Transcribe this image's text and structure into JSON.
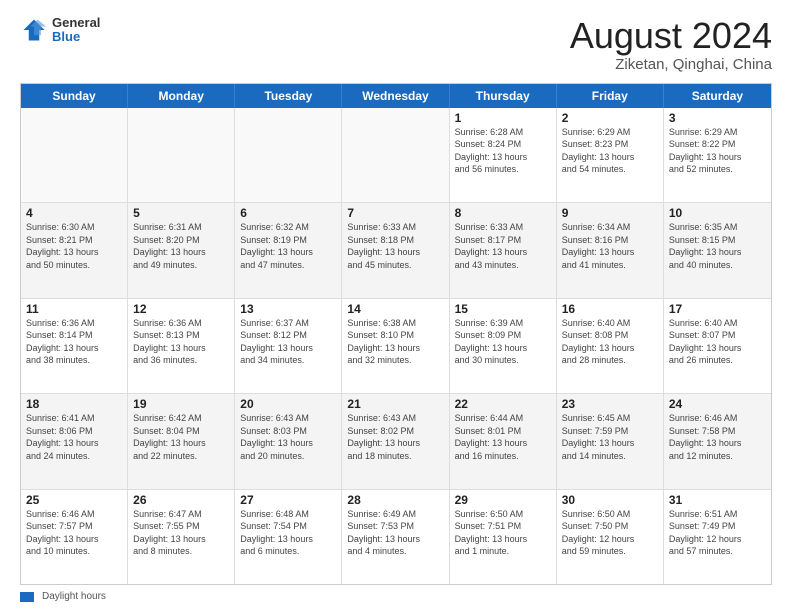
{
  "brand": {
    "general": "General",
    "blue": "Blue"
  },
  "title": {
    "month_year": "August 2024",
    "location": "Ziketan, Qinghai, China"
  },
  "days_of_week": [
    "Sunday",
    "Monday",
    "Tuesday",
    "Wednesday",
    "Thursday",
    "Friday",
    "Saturday"
  ],
  "footer": {
    "label": "Daylight hours"
  },
  "weeks": [
    [
      {
        "day": "",
        "info": ""
      },
      {
        "day": "",
        "info": ""
      },
      {
        "day": "",
        "info": ""
      },
      {
        "day": "",
        "info": ""
      },
      {
        "day": "1",
        "info": "Sunrise: 6:28 AM\nSunset: 8:24 PM\nDaylight: 13 hours\nand 56 minutes."
      },
      {
        "day": "2",
        "info": "Sunrise: 6:29 AM\nSunset: 8:23 PM\nDaylight: 13 hours\nand 54 minutes."
      },
      {
        "day": "3",
        "info": "Sunrise: 6:29 AM\nSunset: 8:22 PM\nDaylight: 13 hours\nand 52 minutes."
      }
    ],
    [
      {
        "day": "4",
        "info": "Sunrise: 6:30 AM\nSunset: 8:21 PM\nDaylight: 13 hours\nand 50 minutes."
      },
      {
        "day": "5",
        "info": "Sunrise: 6:31 AM\nSunset: 8:20 PM\nDaylight: 13 hours\nand 49 minutes."
      },
      {
        "day": "6",
        "info": "Sunrise: 6:32 AM\nSunset: 8:19 PM\nDaylight: 13 hours\nand 47 minutes."
      },
      {
        "day": "7",
        "info": "Sunrise: 6:33 AM\nSunset: 8:18 PM\nDaylight: 13 hours\nand 45 minutes."
      },
      {
        "day": "8",
        "info": "Sunrise: 6:33 AM\nSunset: 8:17 PM\nDaylight: 13 hours\nand 43 minutes."
      },
      {
        "day": "9",
        "info": "Sunrise: 6:34 AM\nSunset: 8:16 PM\nDaylight: 13 hours\nand 41 minutes."
      },
      {
        "day": "10",
        "info": "Sunrise: 6:35 AM\nSunset: 8:15 PM\nDaylight: 13 hours\nand 40 minutes."
      }
    ],
    [
      {
        "day": "11",
        "info": "Sunrise: 6:36 AM\nSunset: 8:14 PM\nDaylight: 13 hours\nand 38 minutes."
      },
      {
        "day": "12",
        "info": "Sunrise: 6:36 AM\nSunset: 8:13 PM\nDaylight: 13 hours\nand 36 minutes."
      },
      {
        "day": "13",
        "info": "Sunrise: 6:37 AM\nSunset: 8:12 PM\nDaylight: 13 hours\nand 34 minutes."
      },
      {
        "day": "14",
        "info": "Sunrise: 6:38 AM\nSunset: 8:10 PM\nDaylight: 13 hours\nand 32 minutes."
      },
      {
        "day": "15",
        "info": "Sunrise: 6:39 AM\nSunset: 8:09 PM\nDaylight: 13 hours\nand 30 minutes."
      },
      {
        "day": "16",
        "info": "Sunrise: 6:40 AM\nSunset: 8:08 PM\nDaylight: 13 hours\nand 28 minutes."
      },
      {
        "day": "17",
        "info": "Sunrise: 6:40 AM\nSunset: 8:07 PM\nDaylight: 13 hours\nand 26 minutes."
      }
    ],
    [
      {
        "day": "18",
        "info": "Sunrise: 6:41 AM\nSunset: 8:06 PM\nDaylight: 13 hours\nand 24 minutes."
      },
      {
        "day": "19",
        "info": "Sunrise: 6:42 AM\nSunset: 8:04 PM\nDaylight: 13 hours\nand 22 minutes."
      },
      {
        "day": "20",
        "info": "Sunrise: 6:43 AM\nSunset: 8:03 PM\nDaylight: 13 hours\nand 20 minutes."
      },
      {
        "day": "21",
        "info": "Sunrise: 6:43 AM\nSunset: 8:02 PM\nDaylight: 13 hours\nand 18 minutes."
      },
      {
        "day": "22",
        "info": "Sunrise: 6:44 AM\nSunset: 8:01 PM\nDaylight: 13 hours\nand 16 minutes."
      },
      {
        "day": "23",
        "info": "Sunrise: 6:45 AM\nSunset: 7:59 PM\nDaylight: 13 hours\nand 14 minutes."
      },
      {
        "day": "24",
        "info": "Sunrise: 6:46 AM\nSunset: 7:58 PM\nDaylight: 13 hours\nand 12 minutes."
      }
    ],
    [
      {
        "day": "25",
        "info": "Sunrise: 6:46 AM\nSunset: 7:57 PM\nDaylight: 13 hours\nand 10 minutes."
      },
      {
        "day": "26",
        "info": "Sunrise: 6:47 AM\nSunset: 7:55 PM\nDaylight: 13 hours\nand 8 minutes."
      },
      {
        "day": "27",
        "info": "Sunrise: 6:48 AM\nSunset: 7:54 PM\nDaylight: 13 hours\nand 6 minutes."
      },
      {
        "day": "28",
        "info": "Sunrise: 6:49 AM\nSunset: 7:53 PM\nDaylight: 13 hours\nand 4 minutes."
      },
      {
        "day": "29",
        "info": "Sunrise: 6:50 AM\nSunset: 7:51 PM\nDaylight: 13 hours\nand 1 minute."
      },
      {
        "day": "30",
        "info": "Sunrise: 6:50 AM\nSunset: 7:50 PM\nDaylight: 12 hours\nand 59 minutes."
      },
      {
        "day": "31",
        "info": "Sunrise: 6:51 AM\nSunset: 7:49 PM\nDaylight: 12 hours\nand 57 minutes."
      }
    ]
  ]
}
